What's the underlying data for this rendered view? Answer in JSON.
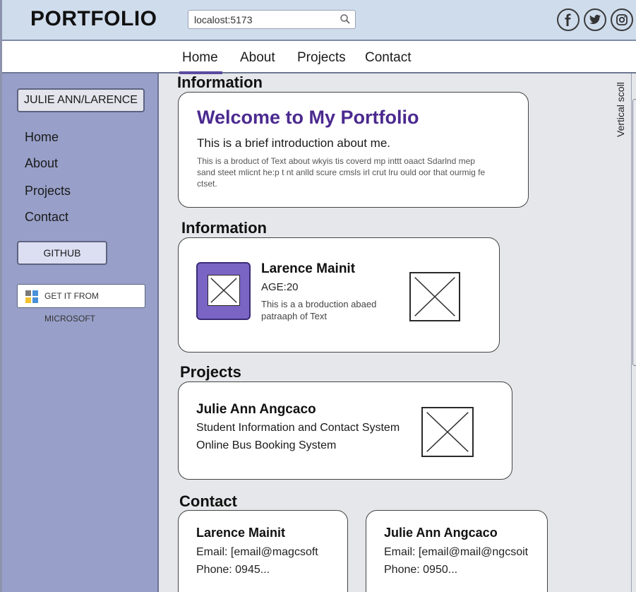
{
  "header": {
    "brand": "PORTFOLIO",
    "address": "localost:5173",
    "socials": [
      "facebook-icon",
      "twitter-icon",
      "instagram-icon"
    ]
  },
  "topnav": {
    "tabs": [
      {
        "label": "Home",
        "active": true
      },
      {
        "label": "About",
        "active": false
      },
      {
        "label": "Projects",
        "active": false
      },
      {
        "label": "Contact",
        "active": false
      }
    ]
  },
  "sidebar": {
    "name_button": "JULIE ANN/LARENCE",
    "links": [
      "Home",
      "About",
      "Projects",
      "Contact"
    ],
    "github_button": "GITHUB",
    "ms_button": "GET IT FROM MICROSOFT"
  },
  "main": {
    "section1": {
      "title": "Information",
      "heading": "Welcome to My Portfolio",
      "subtitle": "This is a brief introduction about me.",
      "body": "This is a broduct of Text about wkyis tis coverd mp inttt oaact Sdarlnd mep sand steet mlicnt he:p t nt anlld scure cmsls irl crut lru ould oor that ourmig fe ctset."
    },
    "section2": {
      "title": "Information",
      "name": "Larence Mainit",
      "age": "AGE:20",
      "paragraph": "This is a a broduction abaed patraaph of Text"
    },
    "projects": {
      "title": "Projects",
      "name": "Julie Ann Angcaco",
      "items": [
        "Student Information and Contact System",
        "Online Bus Booking System"
      ]
    },
    "contact": {
      "title": "Contact",
      "cards": [
        {
          "name": "Larence Mainit",
          "email": "Email: [email@magcsoft",
          "phone": "Phone: 0945..."
        },
        {
          "name": "Julie Ann Angcaco",
          "email": "Email: [email@mail@ngcsoit",
          "phone": "Phone: 0950..."
        }
      ]
    }
  },
  "scroll": {
    "label": "Vertical scoll"
  },
  "colors": {
    "header_bg": "#cfdcec",
    "sidebar_bg": "#98a0c9",
    "accent_purple": "#4b2a8f",
    "profile_frame": "#7a64c4"
  }
}
